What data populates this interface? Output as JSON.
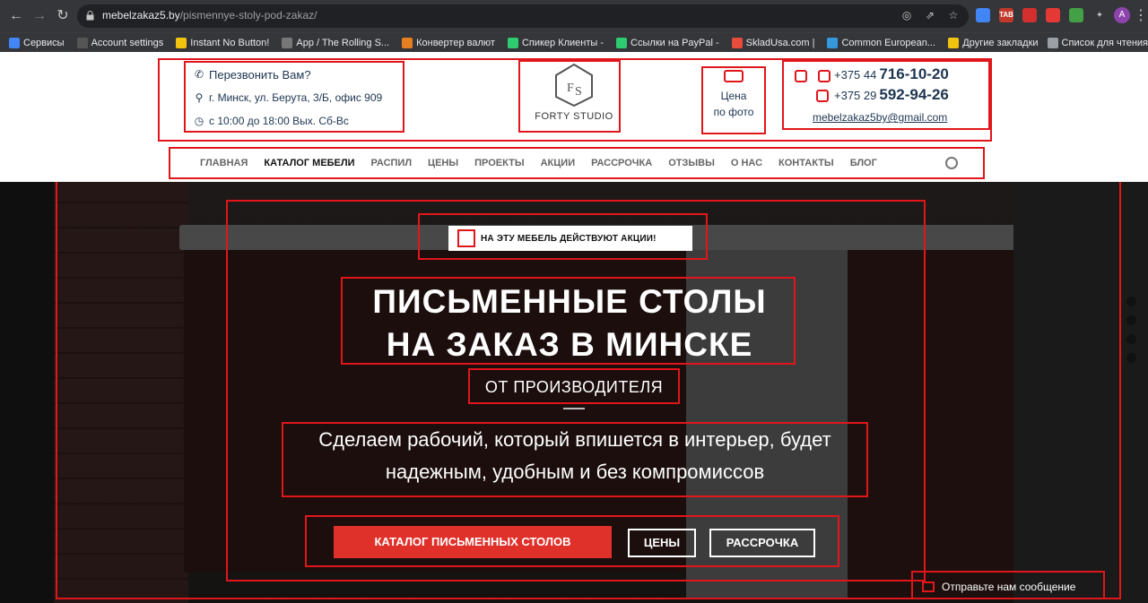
{
  "browser": {
    "url_domain": "mebelzakaz5.by",
    "url_path": "/pismennye-stoly-pod-zakaz/",
    "avatar_letter": "A",
    "extensions": [
      {
        "icon": "translate-icon",
        "color": "#4285f4",
        "label": ""
      },
      {
        "icon": "tab-icon",
        "color": "#c0392b",
        "label": "TAB"
      },
      {
        "icon": "red-ext-icon",
        "color": "#d32f2f",
        "label": ""
      },
      {
        "icon": "target-icon",
        "color": "#e53935",
        "label": ""
      },
      {
        "icon": "check-icon",
        "color": "#43a047",
        "label": ""
      }
    ],
    "bookmarks": [
      {
        "label": "Сервисы",
        "color": "#4285f4"
      },
      {
        "label": "Account settings",
        "color": "#555"
      },
      {
        "label": "Instant No Button!",
        "color": "#f1c40f"
      },
      {
        "label": "App / The Rolling S...",
        "color": "#777"
      },
      {
        "label": "Конвертер валют",
        "color": "#e67e22"
      },
      {
        "label": "Спикер Клиенты -",
        "color": "#2ecc71"
      },
      {
        "label": "Ссылки на PayPal -",
        "color": "#2ecc71"
      },
      {
        "label": "SkladUsa.com |",
        "color": "#e74c3c"
      },
      {
        "label": "Common European...",
        "color": "#3498db"
      }
    ],
    "bookmarks_right": [
      {
        "label": "Другие закладки",
        "color": "#f1c40f"
      },
      {
        "label": "Список для чтения",
        "color": "#9aa0a6"
      }
    ]
  },
  "header": {
    "callback": "Перезвонить Вам?",
    "address": "г. Минск, ул. Берута, 3/Б, офис 909",
    "hours": "с 10:00 до 18:00 Вых. Сб-Вс",
    "logo_text": "FORTY STUDIO",
    "price_photo_line1": "Цена",
    "price_photo_line2": "по фото",
    "phone1_prefix": "+375 44",
    "phone1_number": "716-10-20",
    "phone2_prefix": "+375 29",
    "phone2_number": "592-94-26",
    "email": "mebelzakaz5by@gmail.com"
  },
  "menu": [
    {
      "label": "Главная",
      "active": false
    },
    {
      "label": "Каталог мебели",
      "active": true
    },
    {
      "label": "Распил",
      "active": false
    },
    {
      "label": "Цены",
      "active": false
    },
    {
      "label": "Проекты",
      "active": false
    },
    {
      "label": "Акции",
      "active": false
    },
    {
      "label": "Рассрочка",
      "active": false
    },
    {
      "label": "Отзывы",
      "active": false
    },
    {
      "label": "О нас",
      "active": false
    },
    {
      "label": "Контакты",
      "active": false
    },
    {
      "label": "Блог",
      "active": false
    }
  ],
  "hero": {
    "promo": "На эту мебель действуют акции!",
    "title_line1": "Письменные столы",
    "title_line2": "на заказ в Минске",
    "subtitle": "ОТ ПРОИЗВОДИТЕЛЯ",
    "desc_line1": "Сделаем рабочий, который впишется в интерьер, будет",
    "desc_line2": "надежным, удобным и без компромиссов",
    "btn_catalog": "Каталог письменных столов",
    "btn_prices": "Цены",
    "btn_installment": "Рассрочка",
    "message_widget": "Отправьте нам сообщение"
  }
}
